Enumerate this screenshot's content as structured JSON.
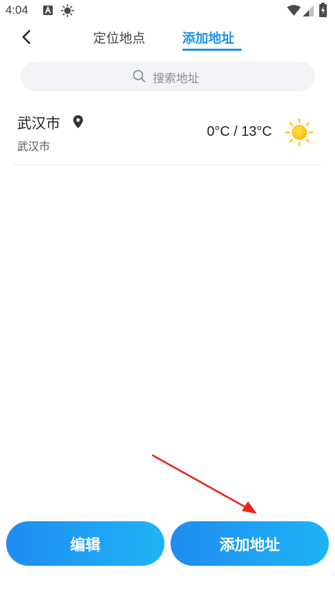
{
  "status_bar": {
    "time": "4:04",
    "icons": [
      "a-notification-icon",
      "sun-notification-icon",
      "wifi-icon",
      "signal-icon",
      "battery-icon"
    ]
  },
  "header": {
    "tabs": [
      {
        "label": "定位地点",
        "active": false
      },
      {
        "label": "添加地址",
        "active": true
      }
    ],
    "accent_color": "#1a92ea"
  },
  "search": {
    "placeholder": "搜索地址"
  },
  "cities": [
    {
      "name": "武汉市",
      "subtitle": "武汉市",
      "temperature": "0°C / 13°C",
      "weather_icon": "sunny-icon",
      "is_located": true
    }
  ],
  "buttons": {
    "edit_label": "编辑",
    "add_label": "添加地址"
  },
  "colors": {
    "button_gradient_start": "#1f8cf0",
    "button_gradient_end": "#1fb4f5",
    "annotation_arrow": "#e8231c"
  }
}
